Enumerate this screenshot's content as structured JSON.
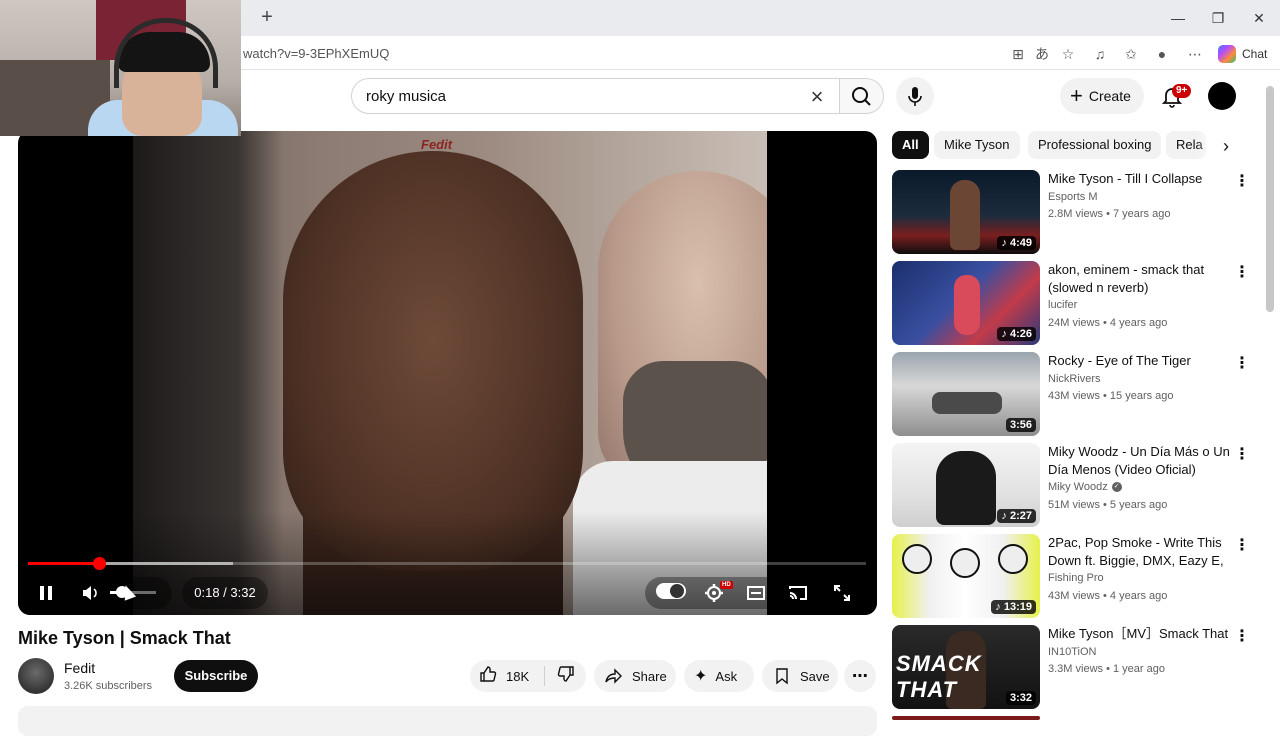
{
  "browser": {
    "url": "watch?v=9-3EPhXEmUQ",
    "new_tab": "+",
    "window_controls": {
      "minimize": "—",
      "restore": "❐",
      "close": "✕"
    },
    "chat_label": "Chat"
  },
  "masthead": {
    "search_value": "roky musica",
    "create_label": "Create",
    "notifications_badge": "9+"
  },
  "player": {
    "watermark": "Fedit",
    "time": "0:18 / 3:32",
    "progress_fraction": 0.085,
    "hd_badge": "HD"
  },
  "video": {
    "title": "Mike Tyson | Smack That",
    "channel_name": "Fedit",
    "channel_subs": "3.26K subscribers",
    "subscribe_label": "Subscribe",
    "like_count": "18K",
    "share_label": "Share",
    "ask_label": "Ask",
    "save_label": "Save"
  },
  "chips": [
    "All",
    "Mike Tyson",
    "Professional boxing",
    "Rela"
  ],
  "recommendations": [
    {
      "title": "Mike Tyson - Till I Collapse",
      "channel": "Esports M",
      "meta": "2.8M views • 7 years ago",
      "duration": "♪ 4:49",
      "verified": false
    },
    {
      "title": "akon, eminem - smack that (slowed n reverb)",
      "channel": "lucifer",
      "meta": "24M views • 4 years ago",
      "duration": "♪ 4:26",
      "verified": false
    },
    {
      "title": "Rocky - Eye of The Tiger",
      "channel": "NickRivers",
      "meta": "43M views • 15 years ago",
      "duration": "3:56",
      "verified": false
    },
    {
      "title": "Miky Woodz - Un Día Más o Un Día Menos (Video Oficial)",
      "channel": "Miky Woodz",
      "meta": "51M views • 5 years ago",
      "duration": "♪ 2:27",
      "verified": true
    },
    {
      "title": "2Pac, Pop Smoke - Write This Down ft. Biggie, DMX, Eazy E, ...",
      "channel": "Fishing Pro",
      "meta": "43M views • 4 years ago",
      "duration": "♪ 13:19",
      "verified": false
    },
    {
      "title": "Mike Tyson［MV］Smack That",
      "channel": "IN10TiON",
      "meta": "3.3M views • 1 year ago",
      "duration": "3:32",
      "verified": false
    }
  ],
  "thumb_overlay_text": "SMACK THAT",
  "colors": {
    "accent": "#ff0000",
    "badge": "#cc0000",
    "chip_active": "#0f0f0f"
  }
}
